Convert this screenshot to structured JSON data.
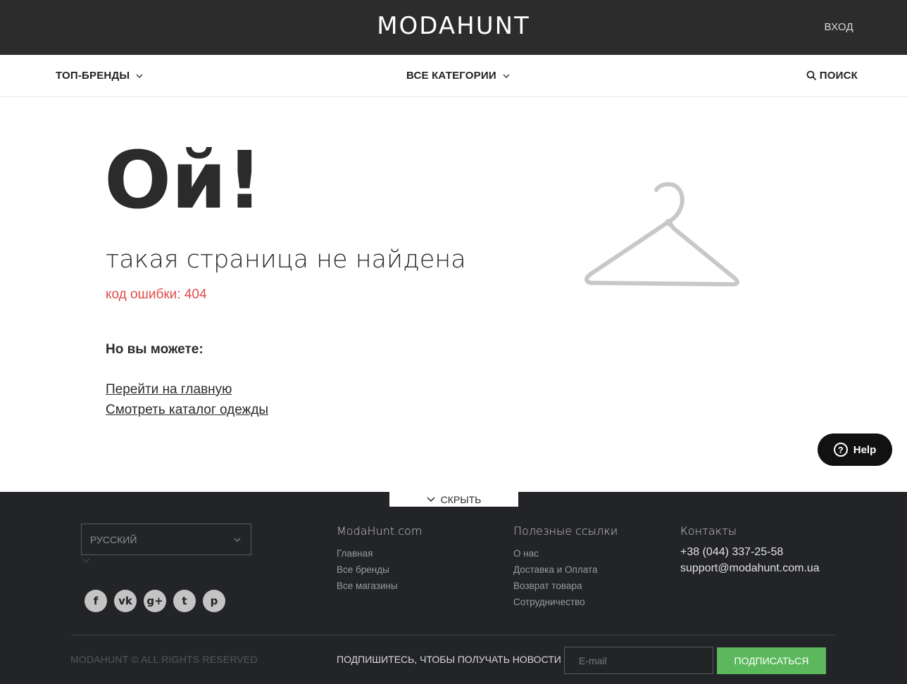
{
  "header": {
    "logo": "MODAHUNT",
    "login_label": "ВХОД"
  },
  "nav": {
    "top_brands": "ТОП-БРЕНДЫ",
    "all_categories": "ВСЕ КАТЕГОРИИ",
    "search": "ПОИСК"
  },
  "error": {
    "headline": "Ой!",
    "subtitle": "такая страница не найдена",
    "code": "код ошибки: 404",
    "suggest_label": "Но вы можете:",
    "links": [
      "Перейти на главную",
      "Смотреть каталог одежды"
    ]
  },
  "help_button": {
    "label": "Help",
    "icon": "question-icon"
  },
  "footer": {
    "hide_tab": "СКРЫТЬ",
    "language": {
      "selected": "РУССКИЙ"
    },
    "socials": [
      {
        "name": "facebook-icon",
        "glyph": "f"
      },
      {
        "name": "vk-icon",
        "glyph": "vk"
      },
      {
        "name": "google-plus-icon",
        "glyph": "g+"
      },
      {
        "name": "twitter-icon",
        "glyph": "t"
      },
      {
        "name": "pinterest-icon",
        "glyph": "p"
      }
    ],
    "col1": {
      "title": "ModaHunt.com",
      "items": [
        "Главная",
        "Все бренды",
        "Все магазины"
      ]
    },
    "col2": {
      "title": "Полезные ссылки",
      "items": [
        "О нас",
        "Доставка и Оплата",
        "Возврат товара",
        "Сотрудничество"
      ]
    },
    "col3": {
      "title": "Контакты",
      "phone": "+38 (044) 337-25-58",
      "email": "support@modahunt.com.ua"
    },
    "copyright": "MODAHUNT © ALL RIGHTS RESERVED",
    "subscribe": {
      "label": "ПОДПИШИТЕСЬ, ЧТОБЫ ПОЛУЧАТЬ НОВОСТИ",
      "placeholder": "E-mail",
      "button": "ПОДПИСАТЬСЯ"
    }
  },
  "colors": {
    "topbar": "#2c2c2c",
    "footer": "#232427",
    "error_code": "#e04b4b",
    "subscribe_button": "#5cb85c",
    "hanger": "#c8c8c8"
  }
}
